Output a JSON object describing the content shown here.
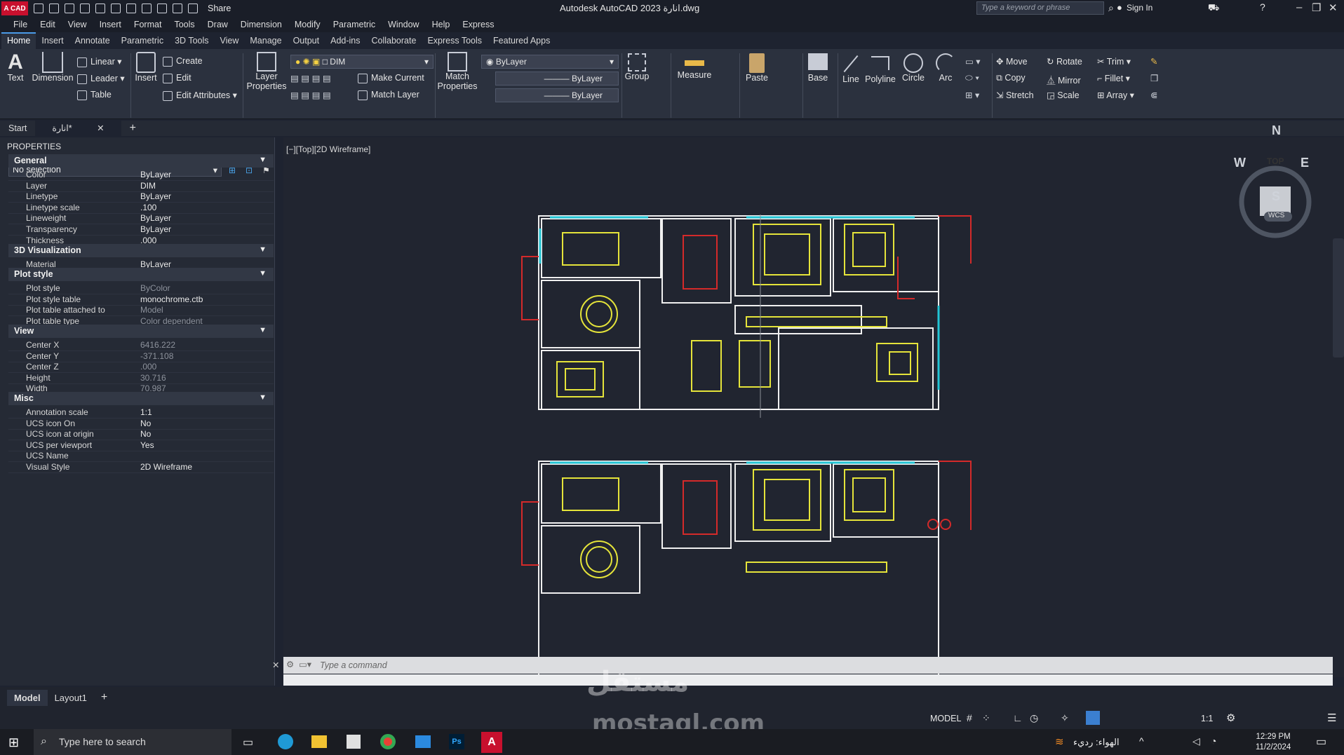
{
  "app": {
    "logo": "A CAD",
    "title": "Autodesk AutoCAD 2023  انارة.dwg",
    "share": "Share",
    "search_placeholder": "Type a keyword or phrase",
    "sign_in": "Sign In"
  },
  "menu": [
    "File",
    "Edit",
    "View",
    "Insert",
    "Format",
    "Tools",
    "Draw",
    "Dimension",
    "Modify",
    "Parametric",
    "Window",
    "Help",
    "Express"
  ],
  "ribbon_tabs": [
    "Home",
    "Insert",
    "Annotate",
    "Parametric",
    "3D Tools",
    "View",
    "Manage",
    "Output",
    "Add-ins",
    "Collaborate",
    "Express Tools",
    "Featured Apps"
  ],
  "ribbon": {
    "text": "Text",
    "dimension": "Dimension",
    "linear": "Linear",
    "leader": "Leader",
    "table": "Table",
    "insert": "Insert",
    "create": "Create",
    "edit": "Edit",
    "edit_attributes": "Edit Attributes",
    "layer_properties": "Layer Properties",
    "layer_current": "DIM",
    "make_current": "Make Current",
    "match_layer": "Match Layer",
    "match_properties": "Match Properties",
    "color": "ByLayer",
    "linetype": "ByLayer",
    "lineweight": "ByLayer",
    "group": "Group",
    "measure": "Measure",
    "paste": "Paste",
    "base": "Base",
    "line": "Line",
    "polyline": "Polyline",
    "circle": "Circle",
    "arc": "Arc",
    "move": "Move",
    "rotate": "Rotate",
    "trim": "Trim",
    "copy": "Copy",
    "mirror": "Mirror",
    "fillet": "Fillet",
    "stretch": "Stretch",
    "scale": "Scale",
    "array": "Array"
  },
  "doc_tabs": {
    "start": "Start",
    "current": "انارة*"
  },
  "properties": {
    "title": "PROPERTIES",
    "selection": "No selection",
    "groups": {
      "general": "General",
      "viz": "3D Visualization",
      "plot": "Plot style",
      "view": "View",
      "misc": "Misc"
    },
    "general": [
      [
        "Color",
        "ByLayer"
      ],
      [
        "Layer",
        "DIM"
      ],
      [
        "Linetype",
        "ByLayer"
      ],
      [
        "Linetype scale",
        ".100"
      ],
      [
        "Lineweight",
        "ByLayer"
      ],
      [
        "Transparency",
        "ByLayer"
      ],
      [
        "Thickness",
        ".000"
      ]
    ],
    "viz": [
      [
        "Material",
        "ByLayer"
      ]
    ],
    "plot": [
      [
        "Plot style",
        "ByColor"
      ],
      [
        "Plot style table",
        "monochrome.ctb"
      ],
      [
        "Plot table attached to",
        "Model"
      ],
      [
        "Plot table type",
        "Color dependent"
      ]
    ],
    "view": [
      [
        "Center X",
        "6416.222"
      ],
      [
        "Center Y",
        "-371.108"
      ],
      [
        "Center Z",
        ".000"
      ],
      [
        "Height",
        "30.716"
      ],
      [
        "Width",
        "70.987"
      ]
    ],
    "misc": [
      [
        "Annotation scale",
        "1:1"
      ],
      [
        "UCS icon On",
        "No"
      ],
      [
        "UCS icon at origin",
        "No"
      ],
      [
        "UCS per viewport",
        "Yes"
      ],
      [
        "UCS Name",
        ""
      ],
      [
        "Visual Style",
        "2D Wireframe"
      ]
    ]
  },
  "viewport": {
    "label": "[−][Top][2D Wireframe]",
    "cube_top": "TOP",
    "n": "N",
    "s": "S",
    "e": "E",
    "w": "W",
    "wcs": "WCS"
  },
  "command": {
    "placeholder": "Type a command"
  },
  "layout_tabs": [
    "Model",
    "Layout1"
  ],
  "status": {
    "model": "MODEL",
    "scale": "1:1"
  },
  "taskbar": {
    "search": "Type here to search",
    "weather": "الهواء: رديء",
    "time": "12:29 PM",
    "date": "11/2/2024"
  },
  "watermark": {
    "arabic": "مستقل",
    "latin": "mostaql.com"
  }
}
